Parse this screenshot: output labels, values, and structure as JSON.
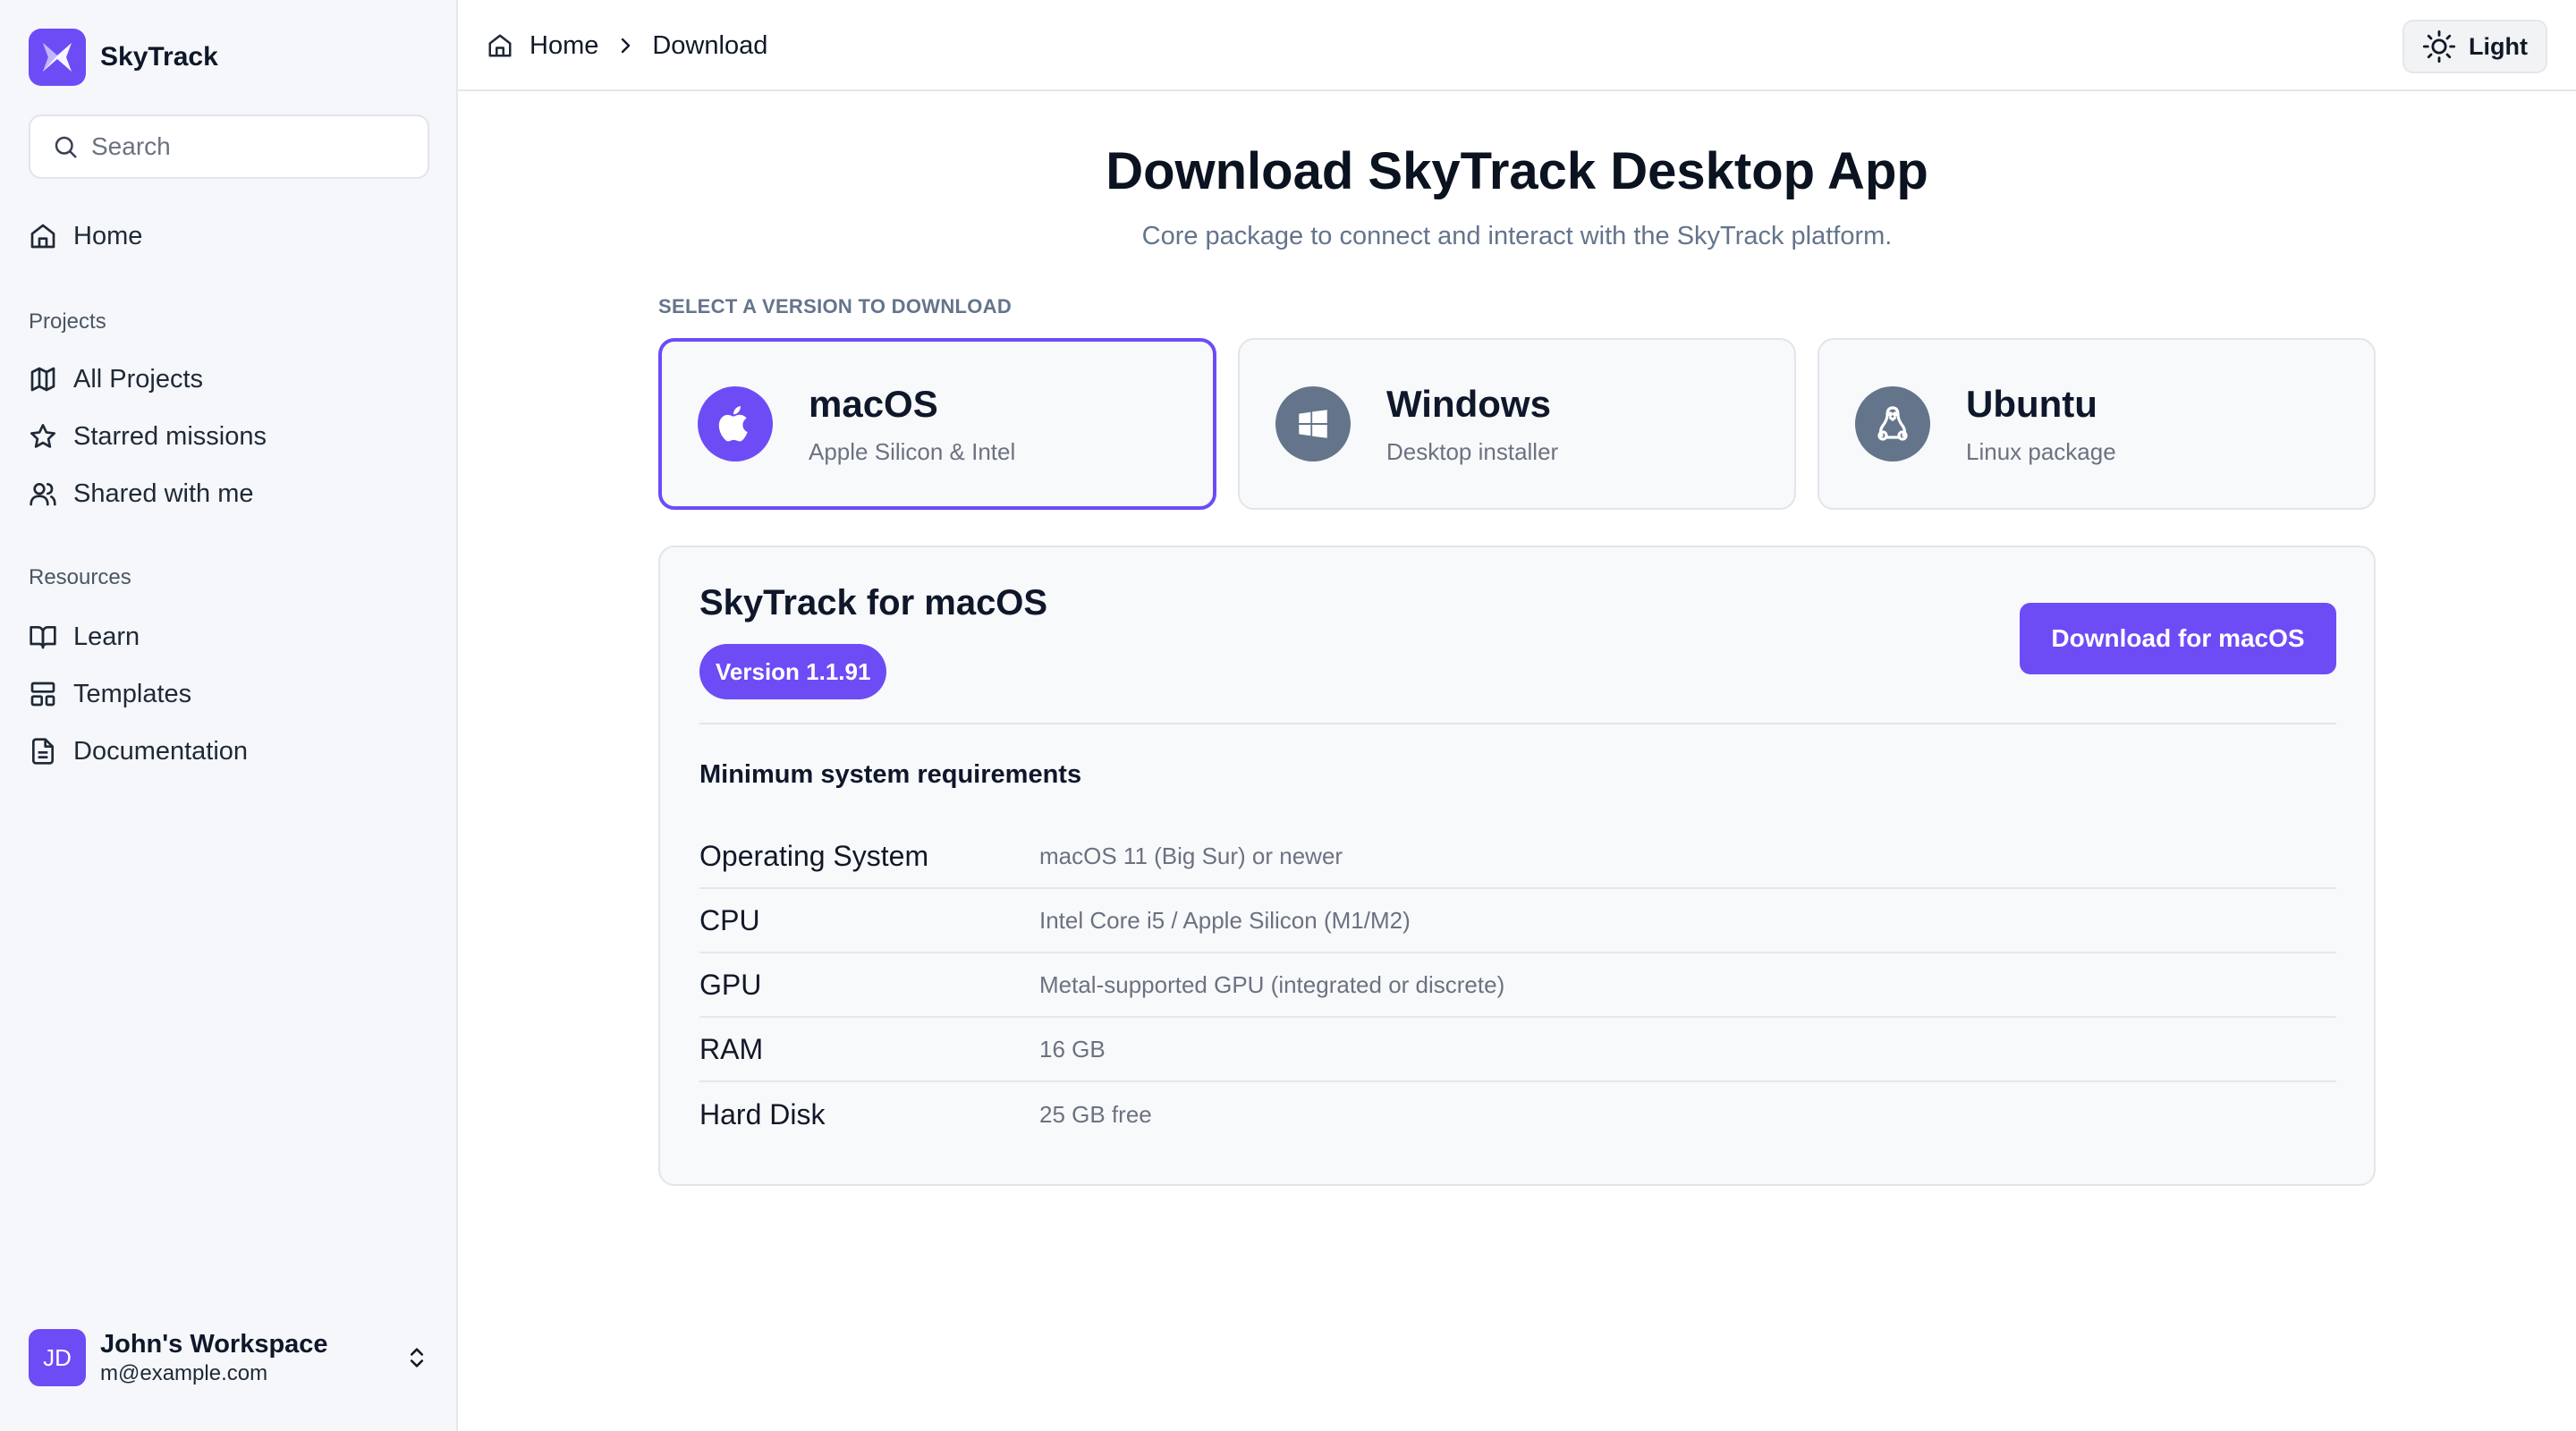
{
  "brand": {
    "name": "SkyTrack",
    "accent": "#6d4cf6"
  },
  "search": {
    "placeholder": "Search"
  },
  "sidebar": {
    "home": {
      "label": "Home",
      "icon": "home-icon"
    },
    "projects_label": "Projects",
    "projects": [
      {
        "label": "All Projects",
        "icon": "map-icon"
      },
      {
        "label": "Starred missions",
        "icon": "star-icon"
      },
      {
        "label": "Shared with me",
        "icon": "users-icon"
      }
    ],
    "resources_label": "Resources",
    "resources": [
      {
        "label": "Learn",
        "icon": "book-open-icon"
      },
      {
        "label": "Templates",
        "icon": "layout-template-icon"
      },
      {
        "label": "Documentation",
        "icon": "file-text-icon"
      }
    ]
  },
  "workspace": {
    "initials": "JD",
    "name": "John's Workspace",
    "email": "m@example.com"
  },
  "breadcrumb": {
    "home": "Home",
    "current": "Download"
  },
  "theme": {
    "label": "Light",
    "icon": "sun-icon"
  },
  "page": {
    "title": "Download SkyTrack Desktop App",
    "subtitle": "Core package to connect and interact with the SkyTrack platform.",
    "select_label": "SELECT A VERSION TO DOWNLOAD"
  },
  "os_options": [
    {
      "name": "macOS",
      "desc": "Apple Silicon & Intel",
      "icon": "apple-icon",
      "color": "#6d4cf6",
      "selected": true
    },
    {
      "name": "Windows",
      "desc": "Desktop installer",
      "icon": "windows-icon",
      "color": "#64748b",
      "selected": false
    },
    {
      "name": "Ubuntu",
      "desc": "Linux package",
      "icon": "linux-icon",
      "color": "#64748b",
      "selected": false
    }
  ],
  "detail": {
    "title": "SkyTrack for macOS",
    "version": "Version 1.1.91",
    "download_label": "Download for macOS",
    "requirements_heading": "Minimum system requirements",
    "requirements": [
      {
        "key": "Operating System",
        "value": "macOS 11 (Big Sur) or newer"
      },
      {
        "key": "CPU",
        "value": "Intel Core i5 / Apple Silicon (M1/M2)"
      },
      {
        "key": "GPU",
        "value": "Metal-supported GPU (integrated or discrete)"
      },
      {
        "key": "RAM",
        "value": "16 GB"
      },
      {
        "key": "Hard Disk",
        "value": "25 GB free"
      }
    ]
  }
}
